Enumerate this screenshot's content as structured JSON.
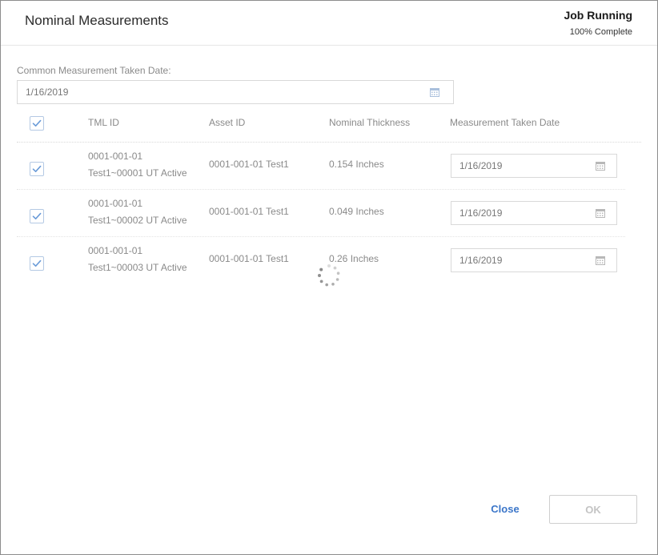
{
  "dialog": {
    "title": "Nominal Measurements",
    "job_status": "Job Running",
    "job_progress_text": "100% Complete"
  },
  "common_date": {
    "label": "Common Measurement Taken Date:",
    "value": "1/16/2019"
  },
  "table": {
    "select_all_checked": true,
    "columns": [
      "TML ID",
      "Asset ID",
      "Nominal Thickness",
      "Measurement Taken Date"
    ],
    "rows": [
      {
        "checked": true,
        "tml_id_line1": "0001-001-01",
        "tml_id_line2": "Test1~00001 UT Active",
        "asset_id": "0001-001-01 Test1",
        "nominal_thickness": "0.154 Inches",
        "measurement_date": "1/16/2019"
      },
      {
        "checked": true,
        "tml_id_line1": "0001-001-01",
        "tml_id_line2": "Test1~00002 UT Active",
        "asset_id": "0001-001-01 Test1",
        "nominal_thickness": "0.049 Inches",
        "measurement_date": "1/16/2019"
      },
      {
        "checked": true,
        "tml_id_line1": "0001-001-01",
        "tml_id_line2": "Test1~00003 UT Active",
        "asset_id": "0001-001-01 Test1",
        "nominal_thickness": "0.26 Inches",
        "measurement_date": "1/16/2019"
      }
    ]
  },
  "footer": {
    "close_label": "Close",
    "ok_label": "OK"
  },
  "icons": {
    "checkbox": "check-icon",
    "date_picker": "calendar-icon",
    "loading": "spinner-icon"
  },
  "colors": {
    "accent": "#3b76c9",
    "checkbox_border": "#b4c9e4",
    "check_mark": "#6a9bd8",
    "muted_text": "#8a8a8a",
    "disabled_text": "#c4c4c4"
  }
}
